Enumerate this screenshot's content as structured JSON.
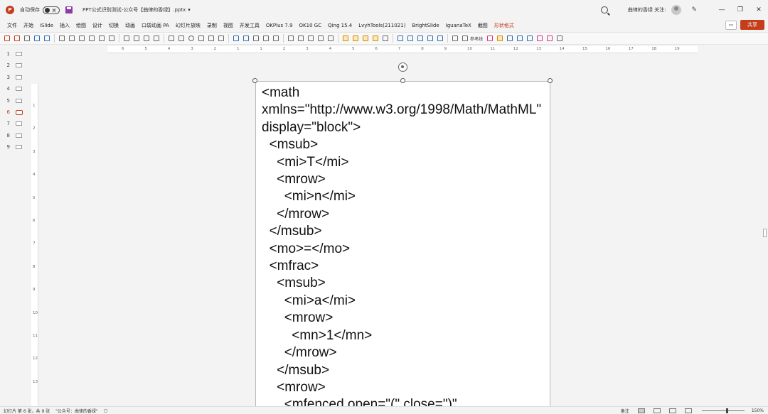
{
  "titlebar": {
    "logo": "P",
    "autosave_label": "自动保存",
    "toggle_state": "关",
    "doc_title": "PPT公式识别测试-公众号【曲律的香绿】.pptx",
    "caret": "▾",
    "user_name": "曲律的香绿 关注:",
    "minimize": "—",
    "restore": "❐",
    "close": "✕"
  },
  "ribbon": {
    "tabs": [
      "文件",
      "开始",
      "iSlide",
      "插入",
      "绘图",
      "设计",
      "切换",
      "动画",
      "口袋动画 PA",
      "幻灯片放映",
      "录制",
      "视图",
      "开发工具",
      "OKPlus 7.9",
      "OK10 GC",
      "Qing 15.4",
      "LvyhTools(211021)",
      "BrightSlide",
      "IguanaTeX",
      "截图",
      "形状格式"
    ],
    "active_tab_index": 20,
    "comment_icon": "comment-icon",
    "share_label": "共享"
  },
  "toolbar": {
    "ref_line_label": "参考线"
  },
  "slides": {
    "items": [
      "1",
      "2",
      "3",
      "4",
      "5",
      "6",
      "7",
      "8",
      "9"
    ],
    "active_index": 5
  },
  "rulers": {
    "horizontal": [
      "6",
      "5",
      "4",
      "3",
      "2",
      "1",
      "1",
      "2",
      "3",
      "4",
      "5",
      "6",
      "7",
      "8",
      "9",
      "10",
      "11",
      "12",
      "13",
      "14",
      "15",
      "16",
      "17",
      "18",
      "19"
    ],
    "vertical": [
      "1",
      "2",
      "3",
      "4",
      "5",
      "6",
      "7",
      "8",
      "9",
      "10",
      "11",
      "12",
      "13"
    ]
  },
  "textbox": {
    "content": "<math\nxmlns=\"http://www.w3.org/1998/Math/MathML\" display=\"block\">\n  <msub>\n    <mi>T</mi>\n    <mrow>\n      <mi>n</mi>\n    </mrow>\n  </msub>\n  <mo>=</mo>\n  <mfrac>\n    <msub>\n      <mi>a</mi>\n      <mrow>\n        <mn>1</mn>\n      </mrow>\n    </msub>\n    <mrow>\n      <mfenced open=\"(\" close=\")\""
  },
  "statusbar": {
    "slide_info": "幻灯片 第 6 张，共 9 张",
    "author": "\"公众号：曲律的香绿\"",
    "notes_label": "备注",
    "zoom": "150%"
  }
}
